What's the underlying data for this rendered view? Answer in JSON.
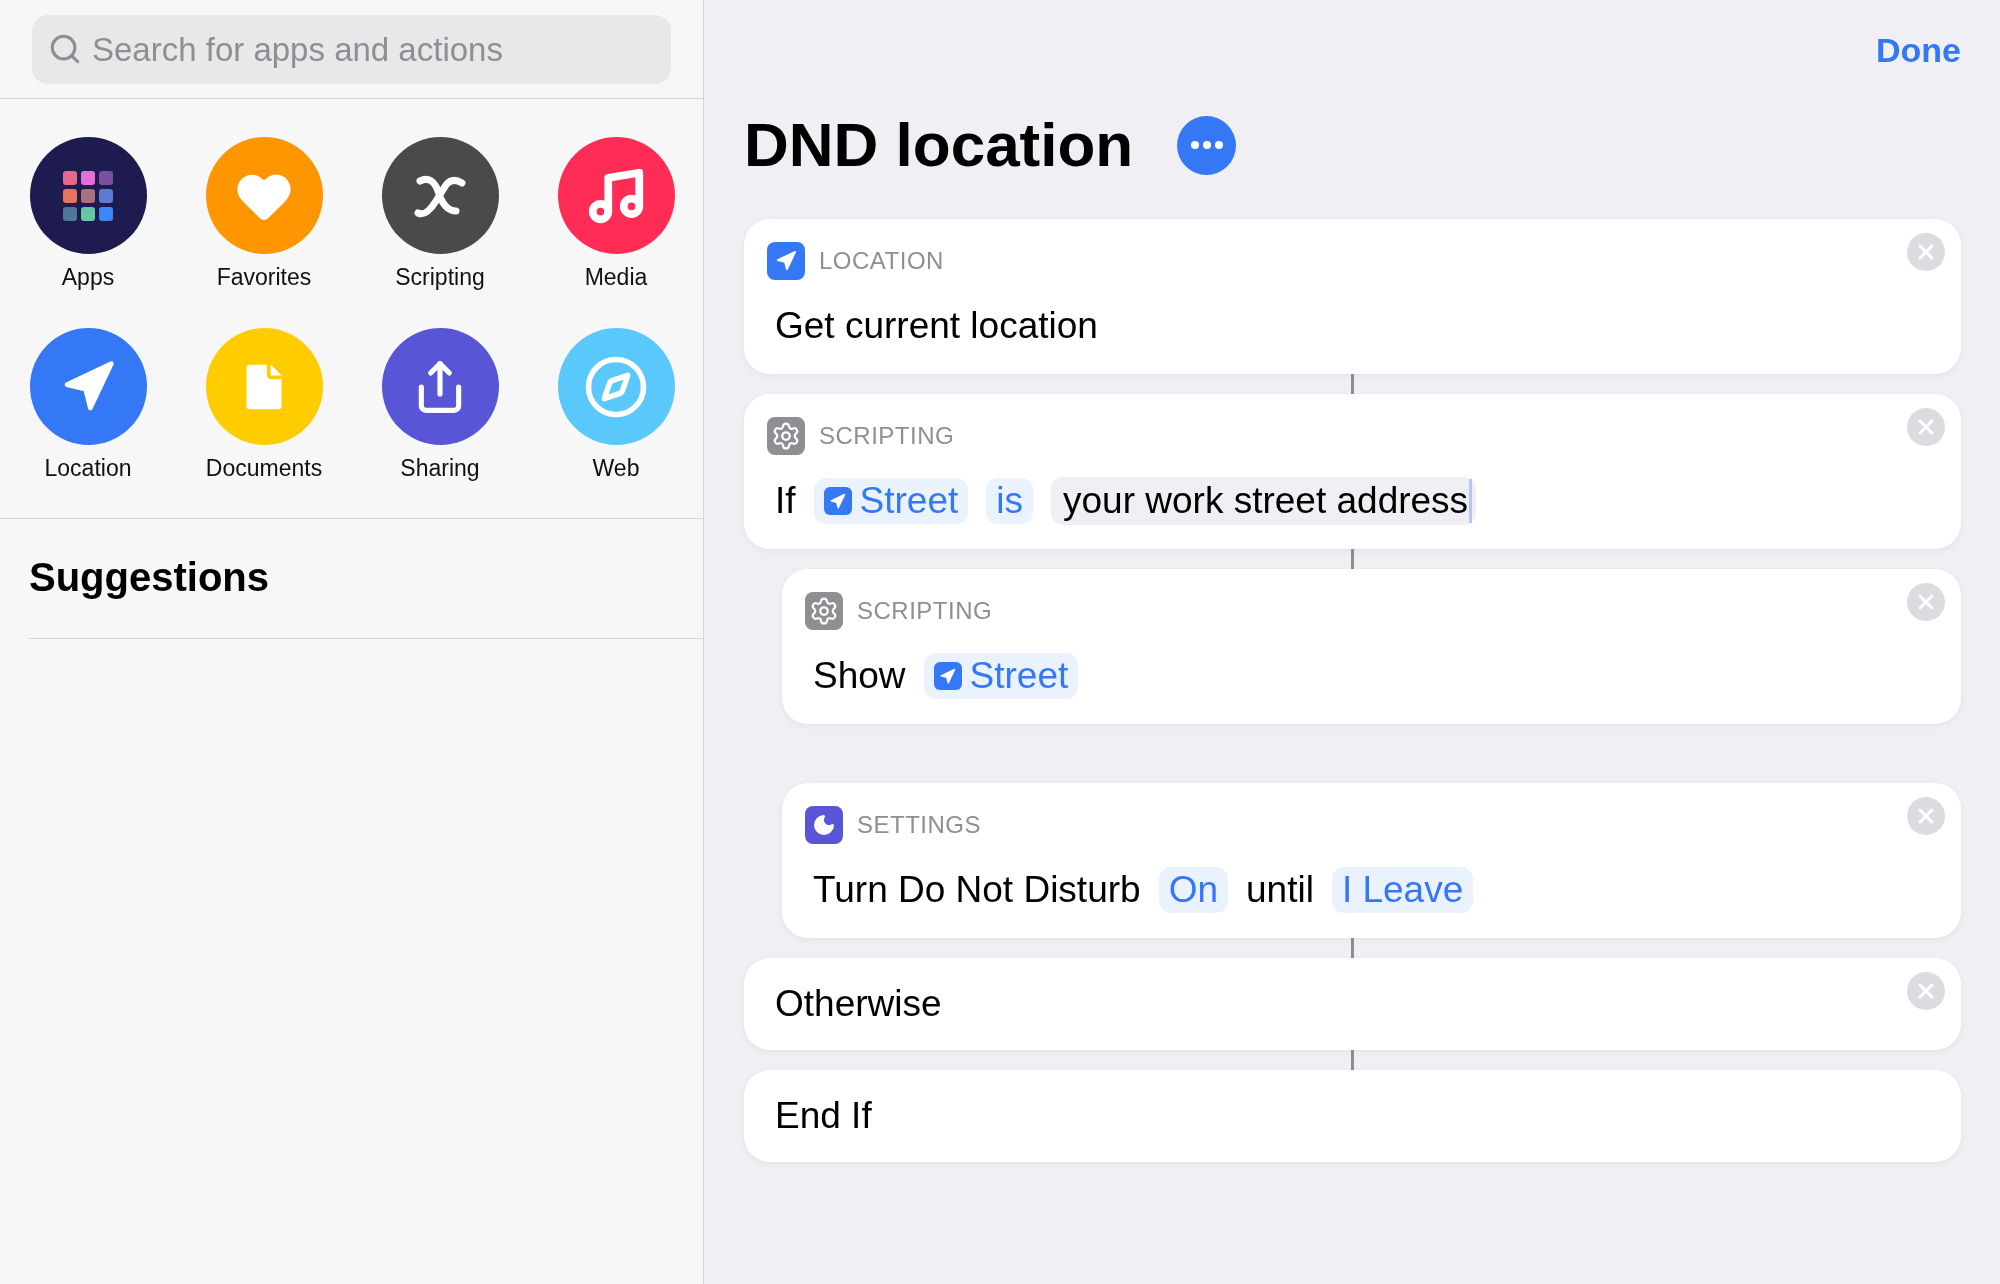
{
  "search": {
    "placeholder": "Search for apps and actions"
  },
  "categories": [
    {
      "label": "Apps",
      "color": "#1d1b4f"
    },
    {
      "label": "Favorites",
      "color": "#ff9500"
    },
    {
      "label": "Scripting",
      "color": "#4a4a4a"
    },
    {
      "label": "Media",
      "color": "#ff2d55"
    },
    {
      "label": "Location",
      "color": "#3478f6"
    },
    {
      "label": "Documents",
      "color": "#ffcc00"
    },
    {
      "label": "Sharing",
      "color": "#5856d6"
    },
    {
      "label": "Web",
      "color": "#5ac8fa"
    }
  ],
  "suggestions": {
    "title": "Suggestions"
  },
  "toolbar": {
    "done": "Done"
  },
  "shortcut": {
    "title": "DND location"
  },
  "actions": [
    {
      "kind": "action",
      "removable": true,
      "header": {
        "kind": "location",
        "label": "LOCATION",
        "color": "#3478f6"
      },
      "parts": [
        {
          "kind": "text",
          "text": "Get current location"
        }
      ]
    },
    {
      "kind": "action",
      "removable": true,
      "header": {
        "kind": "scripting",
        "label": "SCRIPTING",
        "color": "#8e8e93"
      },
      "parts": [
        {
          "kind": "text",
          "text": "If"
        },
        {
          "kind": "variable",
          "text": "Street"
        },
        {
          "kind": "token",
          "text": "is"
        },
        {
          "kind": "input",
          "text": "your work street address",
          "focused": true
        }
      ],
      "children": [
        {
          "kind": "action",
          "removable": true,
          "header": {
            "kind": "scripting",
            "label": "SCRIPTING",
            "color": "#8e8e93"
          },
          "parts": [
            {
              "kind": "text",
              "text": "Show"
            },
            {
              "kind": "variable",
              "text": "Street"
            }
          ]
        },
        {
          "kind": "action",
          "removable": true,
          "header": {
            "kind": "settings",
            "label": "SETTINGS",
            "color": "#5856d6"
          },
          "parts": [
            {
              "kind": "text",
              "text": "Turn Do Not Disturb"
            },
            {
              "kind": "token",
              "text": "On"
            },
            {
              "kind": "text",
              "text": "until"
            },
            {
              "kind": "token",
              "text": "I Leave"
            }
          ]
        }
      ]
    },
    {
      "kind": "marker",
      "removable": true,
      "parts": [
        {
          "kind": "text",
          "text": "Otherwise"
        }
      ]
    },
    {
      "kind": "marker",
      "removable": false,
      "parts": [
        {
          "kind": "text",
          "text": "End If"
        }
      ]
    }
  ]
}
